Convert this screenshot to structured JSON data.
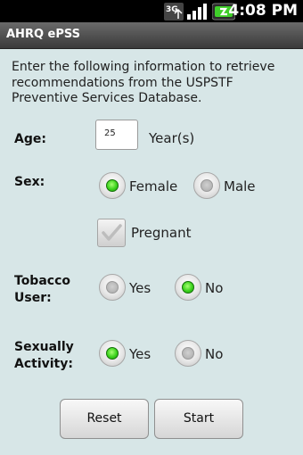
{
  "status_bar": {
    "network": "3G",
    "time": "4:08 PM"
  },
  "app_title": "AHRQ ePSS",
  "intro": "Enter the following information to retrieve recommendations from the USPSTF Preventive Services Database.",
  "age": {
    "label": "Age:",
    "value": "25",
    "unit": "Year(s)"
  },
  "sex": {
    "label": "Sex:",
    "options": [
      "Female",
      "Male"
    ],
    "selected": "Female"
  },
  "pregnant": {
    "label": "Pregnant",
    "checked": false
  },
  "tobacco": {
    "label_line1": "Tobacco",
    "label_line2": "User:",
    "options": [
      "Yes",
      "No"
    ],
    "selected": "No"
  },
  "sexual": {
    "label_line1": "Sexually",
    "label_line2": "Activity:",
    "options": [
      "Yes",
      "No"
    ],
    "selected": "Yes"
  },
  "buttons": {
    "reset": "Reset",
    "start": "Start"
  },
  "colors": {
    "background": "#d7e6e7",
    "selected_radio": "#3bd21c",
    "title_bar": "#4a4a4a"
  }
}
